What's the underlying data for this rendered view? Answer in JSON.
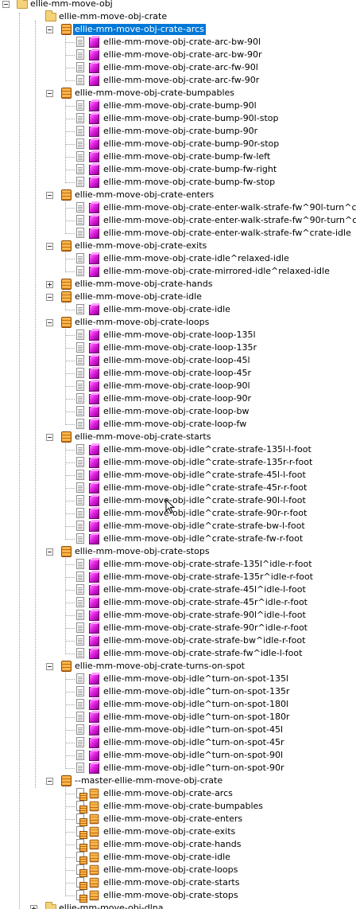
{
  "tree": [
    {
      "label": "ellie-mm-move-obj",
      "depth": 0,
      "icon": "folder-icon",
      "expander": "minus"
    },
    {
      "label": "ellie-mm-move-obj-crate",
      "depth": 1,
      "icon": "folder-icon",
      "expander": "none"
    },
    {
      "label": "ellie-mm-move-obj-crate-arcs",
      "depth": 2,
      "icon": "package-icon",
      "expander": "minus",
      "selected": true
    },
    {
      "label": "ellie-mm-move-obj-crate-arc-bw-90l",
      "depth": 3,
      "icon": "animation-cube-icon"
    },
    {
      "label": "ellie-mm-move-obj-crate-arc-bw-90r",
      "depth": 3,
      "icon": "animation-cube-icon"
    },
    {
      "label": "ellie-mm-move-obj-crate-arc-fw-90l",
      "depth": 3,
      "icon": "animation-cube-icon"
    },
    {
      "label": "ellie-mm-move-obj-crate-arc-fw-90r",
      "depth": 3,
      "icon": "animation-cube-icon"
    },
    {
      "label": "ellie-mm-move-obj-crate-bumpables",
      "depth": 2,
      "icon": "package-icon",
      "expander": "minus"
    },
    {
      "label": "ellie-mm-move-obj-crate-bump-90l",
      "depth": 3,
      "icon": "animation-cube-icon"
    },
    {
      "label": "ellie-mm-move-obj-crate-bump-90l-stop",
      "depth": 3,
      "icon": "animation-cube-icon"
    },
    {
      "label": "ellie-mm-move-obj-crate-bump-90r",
      "depth": 3,
      "icon": "animation-cube-icon"
    },
    {
      "label": "ellie-mm-move-obj-crate-bump-90r-stop",
      "depth": 3,
      "icon": "animation-cube-icon"
    },
    {
      "label": "ellie-mm-move-obj-crate-bump-fw-left",
      "depth": 3,
      "icon": "animation-cube-icon"
    },
    {
      "label": "ellie-mm-move-obj-crate-bump-fw-right",
      "depth": 3,
      "icon": "animation-cube-icon"
    },
    {
      "label": "ellie-mm-move-obj-crate-bump-fw-stop",
      "depth": 3,
      "icon": "animation-cube-icon"
    },
    {
      "label": "ellie-mm-move-obj-crate-enters",
      "depth": 2,
      "icon": "package-icon",
      "expander": "minus"
    },
    {
      "label": "ellie-mm-move-obj-crate-enter-walk-strafe-fw^90l-turn^crate-i",
      "depth": 3,
      "icon": "animation-cube-icon"
    },
    {
      "label": "ellie-mm-move-obj-crate-enter-walk-strafe-fw^90r-turn^crate-i",
      "depth": 3,
      "icon": "animation-cube-icon"
    },
    {
      "label": "ellie-mm-move-obj-crate-enter-walk-strafe-fw^crate-idle",
      "depth": 3,
      "icon": "animation-cube-icon"
    },
    {
      "label": "ellie-mm-move-obj-crate-exits",
      "depth": 2,
      "icon": "package-icon",
      "expander": "minus"
    },
    {
      "label": "ellie-mm-move-obj-crate-idle^relaxed-idle",
      "depth": 3,
      "icon": "animation-cube-icon"
    },
    {
      "label": "ellie-mm-move-obj-crate-mirrored-idle^relaxed-idle",
      "depth": 3,
      "icon": "animation-cube-icon"
    },
    {
      "label": "ellie-mm-move-obj-crate-hands",
      "depth": 2,
      "icon": "package-icon",
      "expander": "plus"
    },
    {
      "label": "ellie-mm-move-obj-crate-idle",
      "depth": 2,
      "icon": "package-icon",
      "expander": "minus"
    },
    {
      "label": "ellie-mm-move-obj-crate-idle",
      "depth": 3,
      "icon": "animation-cube-icon"
    },
    {
      "label": "ellie-mm-move-obj-crate-loops",
      "depth": 2,
      "icon": "package-icon",
      "expander": "minus"
    },
    {
      "label": "ellie-mm-move-obj-crate-loop-135l",
      "depth": 3,
      "icon": "animation-cube-icon"
    },
    {
      "label": "ellie-mm-move-obj-crate-loop-135r",
      "depth": 3,
      "icon": "animation-cube-icon"
    },
    {
      "label": "ellie-mm-move-obj-crate-loop-45l",
      "depth": 3,
      "icon": "animation-cube-icon"
    },
    {
      "label": "ellie-mm-move-obj-crate-loop-45r",
      "depth": 3,
      "icon": "animation-cube-icon"
    },
    {
      "label": "ellie-mm-move-obj-crate-loop-90l",
      "depth": 3,
      "icon": "animation-cube-icon"
    },
    {
      "label": "ellie-mm-move-obj-crate-loop-90r",
      "depth": 3,
      "icon": "animation-cube-icon"
    },
    {
      "label": "ellie-mm-move-obj-crate-loop-bw",
      "depth": 3,
      "icon": "animation-cube-icon"
    },
    {
      "label": "ellie-mm-move-obj-crate-loop-fw",
      "depth": 3,
      "icon": "animation-cube-icon"
    },
    {
      "label": "ellie-mm-move-obj-crate-starts",
      "depth": 2,
      "icon": "package-icon",
      "expander": "minus"
    },
    {
      "label": "ellie-mm-move-obj-idle^crate-strafe-135l-l-foot",
      "depth": 3,
      "icon": "animation-cube-icon"
    },
    {
      "label": "ellie-mm-move-obj-idle^crate-strafe-135r-r-foot",
      "depth": 3,
      "icon": "animation-cube-icon"
    },
    {
      "label": "ellie-mm-move-obj-idle^crate-strafe-45l-l-foot",
      "depth": 3,
      "icon": "animation-cube-icon"
    },
    {
      "label": "ellie-mm-move-obj-idle^crate-strafe-45r-r-foot",
      "depth": 3,
      "icon": "animation-cube-icon"
    },
    {
      "label": "ellie-mm-move-obj-idle^crate-strafe-90l-l-foot",
      "depth": 3,
      "icon": "animation-cube-icon"
    },
    {
      "label": "ellie-mm-move-obj-idle^crate-strafe-90r-r-foot",
      "depth": 3,
      "icon": "animation-cube-icon"
    },
    {
      "label": "ellie-mm-move-obj-idle^crate-strafe-bw-l-foot",
      "depth": 3,
      "icon": "animation-cube-icon"
    },
    {
      "label": "ellie-mm-move-obj-idle^crate-strafe-fw-r-foot",
      "depth": 3,
      "icon": "animation-cube-icon"
    },
    {
      "label": "ellie-mm-move-obj-crate-stops",
      "depth": 2,
      "icon": "package-icon",
      "expander": "minus"
    },
    {
      "label": "ellie-mm-move-obj-crate-strafe-135l^idle-r-foot",
      "depth": 3,
      "icon": "animation-cube-icon"
    },
    {
      "label": "ellie-mm-move-obj-crate-strafe-135r^idle-r-foot",
      "depth": 3,
      "icon": "animation-cube-icon"
    },
    {
      "label": "ellie-mm-move-obj-crate-strafe-45l^idle-l-foot",
      "depth": 3,
      "icon": "animation-cube-icon"
    },
    {
      "label": "ellie-mm-move-obj-crate-strafe-45r^idle-r-foot",
      "depth": 3,
      "icon": "animation-cube-icon"
    },
    {
      "label": "ellie-mm-move-obj-crate-strafe-90l^idle-l-foot",
      "depth": 3,
      "icon": "animation-cube-icon"
    },
    {
      "label": "ellie-mm-move-obj-crate-strafe-90r^idle-r-foot",
      "depth": 3,
      "icon": "animation-cube-icon"
    },
    {
      "label": "ellie-mm-move-obj-crate-strafe-bw^idle-r-foot",
      "depth": 3,
      "icon": "animation-cube-icon"
    },
    {
      "label": "ellie-mm-move-obj-crate-strafe-fw^idle-l-foot",
      "depth": 3,
      "icon": "animation-cube-icon"
    },
    {
      "label": "ellie-mm-move-obj-crate-turns-on-spot",
      "depth": 2,
      "icon": "package-icon",
      "expander": "minus"
    },
    {
      "label": "ellie-mm-move-obj-idle^turn-on-spot-135l",
      "depth": 3,
      "icon": "animation-cube-icon"
    },
    {
      "label": "ellie-mm-move-obj-idle^turn-on-spot-135r",
      "depth": 3,
      "icon": "animation-cube-icon"
    },
    {
      "label": "ellie-mm-move-obj-idle^turn-on-spot-180l",
      "depth": 3,
      "icon": "animation-cube-icon"
    },
    {
      "label": "ellie-mm-move-obj-idle^turn-on-spot-180r",
      "depth": 3,
      "icon": "animation-cube-icon"
    },
    {
      "label": "ellie-mm-move-obj-idle^turn-on-spot-45l",
      "depth": 3,
      "icon": "animation-cube-icon"
    },
    {
      "label": "ellie-mm-move-obj-idle^turn-on-spot-45r",
      "depth": 3,
      "icon": "animation-cube-icon"
    },
    {
      "label": "ellie-mm-move-obj-idle^turn-on-spot-90l",
      "depth": 3,
      "icon": "animation-cube-icon"
    },
    {
      "label": "ellie-mm-move-obj-idle^turn-on-spot-90r",
      "depth": 3,
      "icon": "animation-cube-icon"
    },
    {
      "label": "--master-ellie-mm-move-obj-crate",
      "depth": 2,
      "icon": "package-icon",
      "expander": "minus"
    },
    {
      "label": "ellie-mm-move-obj-crate-arcs",
      "depth": 3,
      "icon": "package-link-icon"
    },
    {
      "label": "ellie-mm-move-obj-crate-bumpables",
      "depth": 3,
      "icon": "package-link-icon"
    },
    {
      "label": "ellie-mm-move-obj-crate-enters",
      "depth": 3,
      "icon": "package-link-icon"
    },
    {
      "label": "ellie-mm-move-obj-crate-exits",
      "depth": 3,
      "icon": "package-link-icon"
    },
    {
      "label": "ellie-mm-move-obj-crate-hands",
      "depth": 3,
      "icon": "package-link-icon"
    },
    {
      "label": "ellie-mm-move-obj-crate-idle",
      "depth": 3,
      "icon": "package-link-icon"
    },
    {
      "label": "ellie-mm-move-obj-crate-loops",
      "depth": 3,
      "icon": "package-link-icon"
    },
    {
      "label": "ellie-mm-move-obj-crate-starts",
      "depth": 3,
      "icon": "package-link-icon"
    },
    {
      "label": "ellie-mm-move-obj-crate-stops",
      "depth": 3,
      "icon": "package-link-icon"
    },
    {
      "label": "ellie-mm-move-obj-dlna",
      "depth": 1,
      "icon": "folder-icon",
      "expander": "plus"
    }
  ],
  "colors": {
    "selection": "#0078d7",
    "selection_text": "#ffffff"
  }
}
